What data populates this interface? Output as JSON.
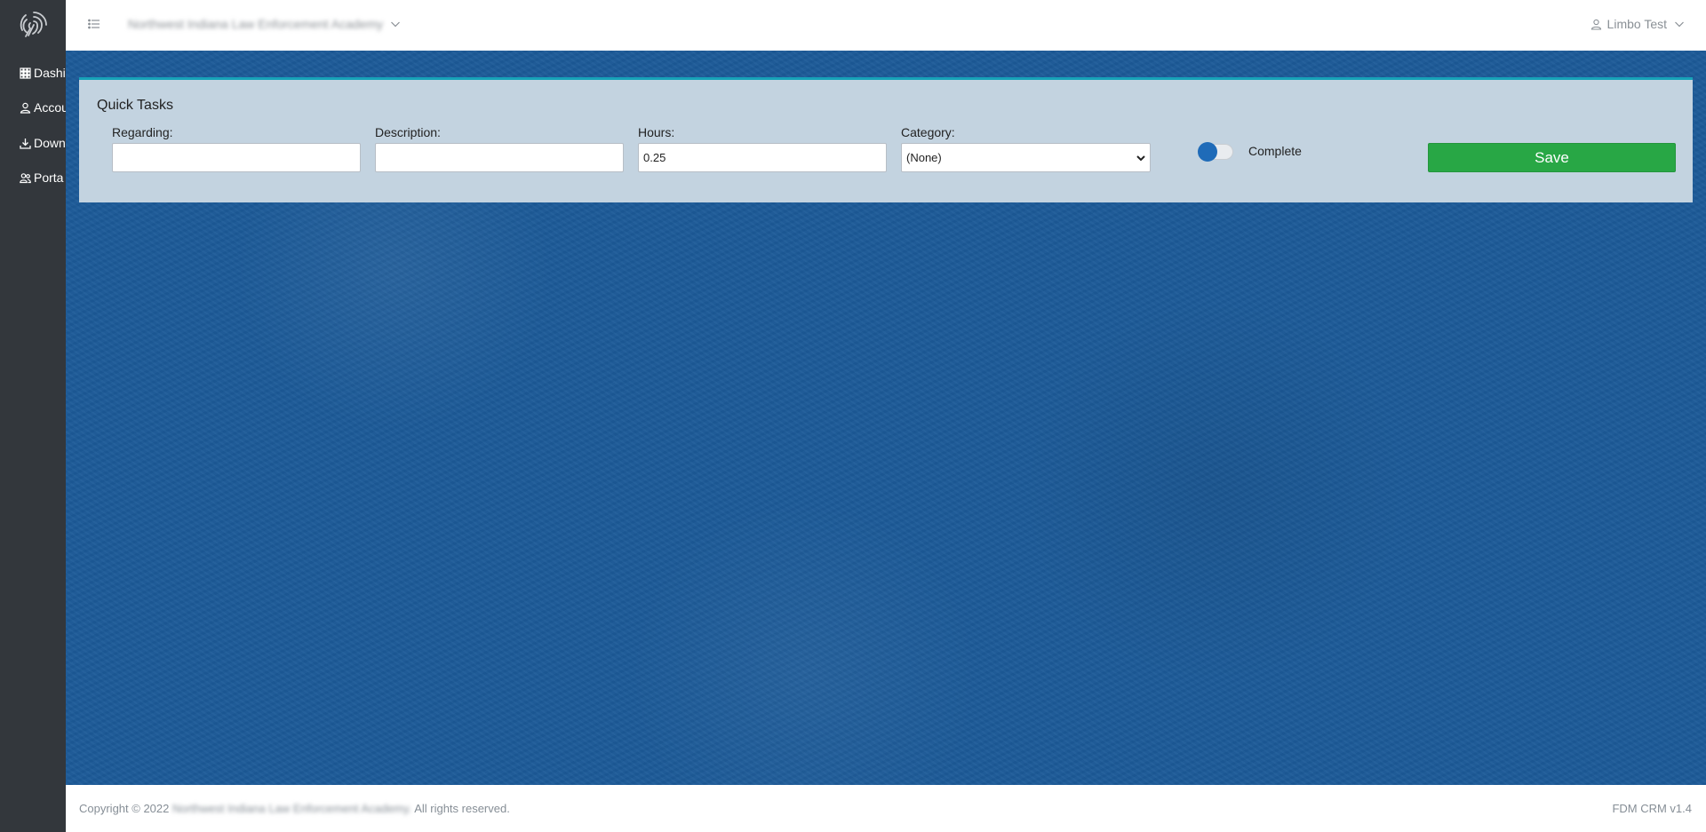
{
  "sidebar": {
    "logo_icon": "fingerprint-icon",
    "items": [
      {
        "label": "Dashi",
        "icon": "grid-icon"
      },
      {
        "label": "Accou",
        "icon": "user-icon"
      },
      {
        "label": "Down",
        "icon": "download-icon"
      },
      {
        "label": "Porta",
        "icon": "users-icon"
      }
    ]
  },
  "topbar": {
    "organization": "Northwest Indiana Law Enforcement Academy",
    "user_name": "Limbo Test"
  },
  "quick_tasks": {
    "title": "Quick Tasks",
    "regarding": {
      "label": "Regarding:",
      "value": ""
    },
    "description": {
      "label": "Description:",
      "value": ""
    },
    "hours": {
      "label": "Hours:",
      "value": "0.25"
    },
    "category": {
      "label": "Category:",
      "selected": "(None)"
    },
    "complete": {
      "label": "Complete",
      "checked": false
    },
    "save_label": "Save"
  },
  "footer": {
    "copyright_prefix": "Copyright © 2022",
    "organization": "Northwest Indiana Law Enforcement Academy.",
    "rights": "All rights reserved.",
    "version": "FDM CRM v1.4"
  },
  "colors": {
    "sidebar": "#33373c",
    "background": "#1c5a98",
    "panel": "#c3d3e0",
    "panel_accent": "#17a2b8",
    "save": "#28a745",
    "toggle_knob": "#1f6bb8"
  }
}
